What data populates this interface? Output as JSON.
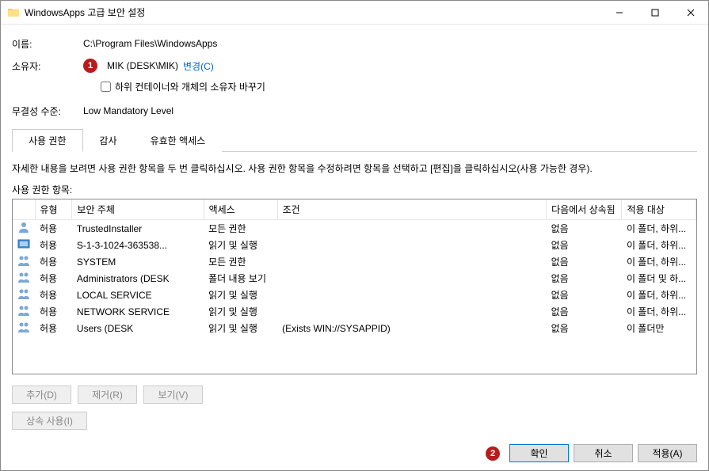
{
  "titlebar": {
    "title": "WindowsApps 고급 보안 설정"
  },
  "info": {
    "name_label": "이름:",
    "name_value": "C:\\Program Files\\WindowsApps",
    "owner_label": "소유자:",
    "owner_value": "MIK (DESK\\MIK)",
    "change_link": "변경(C)",
    "replace_owner_checkbox": "하위 컨테이너와 개체의 소유자 바꾸기",
    "integrity_label": "무결성 수준:",
    "integrity_value": "Low Mandatory Level"
  },
  "markers": {
    "owner": "1",
    "ok": "2"
  },
  "tabs": [
    {
      "label": "사용 권한",
      "active": true
    },
    {
      "label": "감사",
      "active": false
    },
    {
      "label": "유효한 액세스",
      "active": false
    }
  ],
  "instruction": "자세한 내용을 보려면 사용 권한 항목을 두 번 클릭하십시오. 사용 권한 항목을 수정하려면 항목을 선택하고 [편집]을 클릭하십시오(사용 가능한 경우).",
  "list_label": "사용 권한 항목:",
  "columns": {
    "type": "유형",
    "principal": "보안 주체",
    "access": "액세스",
    "condition": "조건",
    "inherited": "다음에서 상속됨",
    "applies": "적용 대상"
  },
  "entries": [
    {
      "icon": "single",
      "type": "허용",
      "principal": "TrustedInstaller",
      "access": "모든 권한",
      "condition": "",
      "inherited": "없음",
      "applies": "이 폴더, 하위..."
    },
    {
      "icon": "all",
      "type": "허용",
      "principal": "S-1-3-1024-363538...",
      "access": "읽기 및 실행",
      "condition": "",
      "inherited": "없음",
      "applies": "이 폴더, 하위..."
    },
    {
      "icon": "group",
      "type": "허용",
      "principal": "SYSTEM",
      "access": "모든 권한",
      "condition": "",
      "inherited": "없음",
      "applies": "이 폴더, 하위..."
    },
    {
      "icon": "group",
      "type": "허용",
      "principal": "Administrators (DESK",
      "access": "폴더 내용 보기",
      "condition": "",
      "inherited": "없음",
      "applies": "이 폴더 및 하..."
    },
    {
      "icon": "group",
      "type": "허용",
      "principal": "LOCAL SERVICE",
      "access": "읽기 및 실행",
      "condition": "",
      "inherited": "없음",
      "applies": "이 폴더, 하위..."
    },
    {
      "icon": "group",
      "type": "허용",
      "principal": "NETWORK SERVICE",
      "access": "읽기 및 실행",
      "condition": "",
      "inherited": "없음",
      "applies": "이 폴더, 하위..."
    },
    {
      "icon": "group",
      "type": "허용",
      "principal": "Users (DESK",
      "access": "읽기 및 실행",
      "condition": "(Exists WIN://SYSAPPID)",
      "inherited": "없음",
      "applies": "이 폴더만"
    }
  ],
  "buttons": {
    "add": "추가(D)",
    "remove": "제거(R)",
    "view": "보기(V)",
    "inherit": "상속 사용(I)",
    "ok": "확인",
    "cancel": "취소",
    "apply": "적용(A)"
  }
}
